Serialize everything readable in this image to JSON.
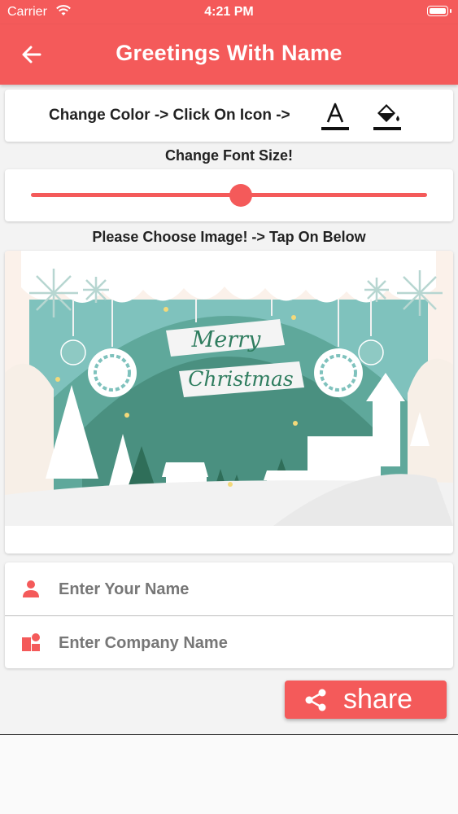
{
  "status_bar": {
    "carrier": "Carrier",
    "time": "4:21 PM"
  },
  "app_bar": {
    "title": "Greetings With Name",
    "back_icon": "arrow-left-icon"
  },
  "color_row": {
    "label": "Change Color -> Click On Icon ->",
    "text_color_icon": "text-color-icon",
    "fill_color_icon": "paint-bucket-icon"
  },
  "font_size": {
    "label": "Change Font Size!",
    "value": 0.53
  },
  "image_section": {
    "label": "Please Choose Image! -> Tap On Below"
  },
  "greeting_image": {
    "line1": "Merry",
    "line2": "Christmas"
  },
  "form": {
    "name_placeholder": "Enter Your Name",
    "company_placeholder": "Enter Company Name",
    "name_value": "",
    "company_value": ""
  },
  "share": {
    "label": "share",
    "icon": "share-icon"
  },
  "colors": {
    "accent": "#f45a5a",
    "teal": "#5fa89b"
  }
}
